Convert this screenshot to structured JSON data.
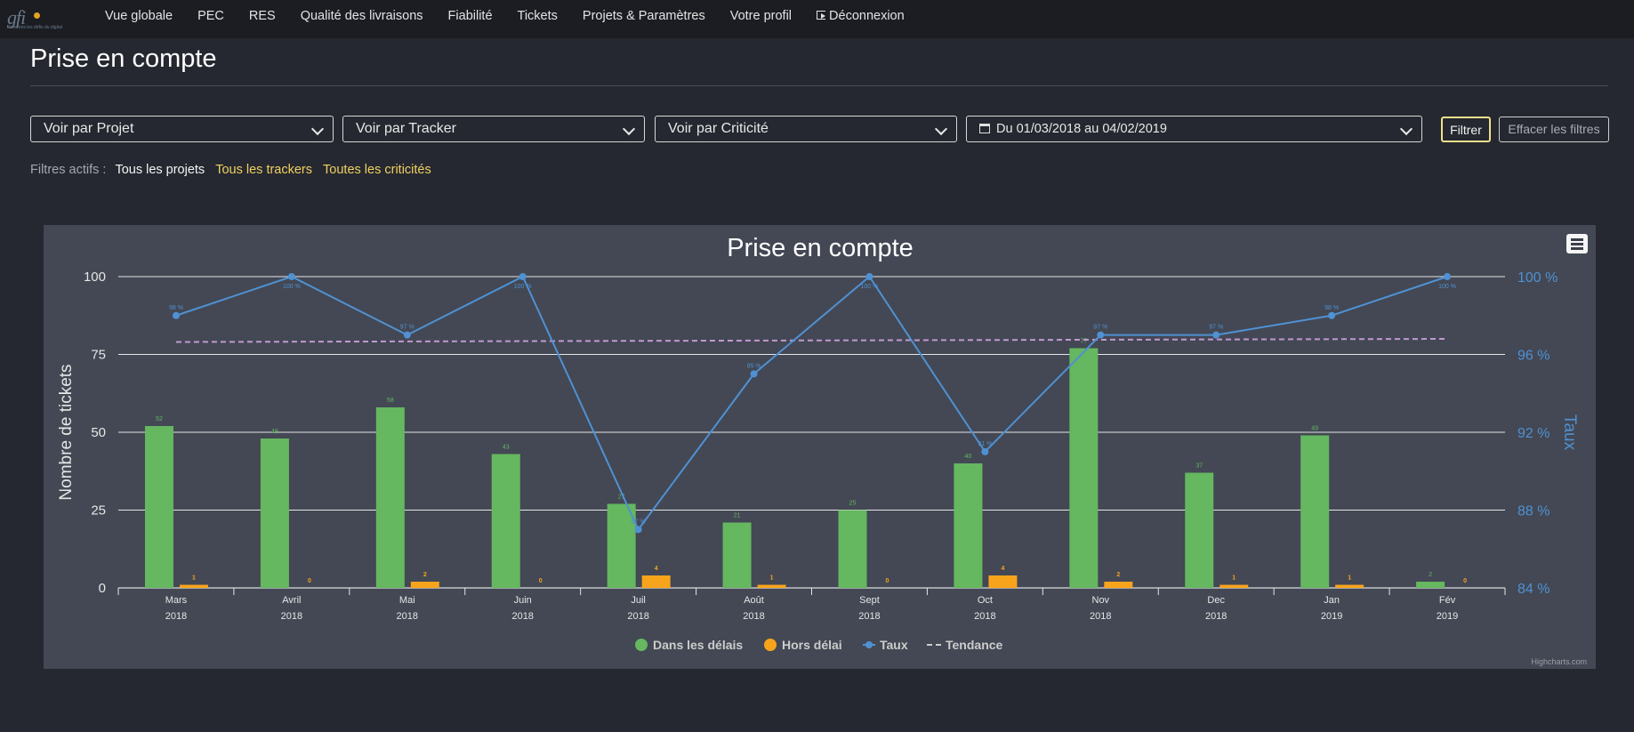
{
  "brand": {
    "logo_text": "gfi",
    "tagline": "Relevons les défis du digital"
  },
  "nav": [
    {
      "label": "Vue globale"
    },
    {
      "label": "PEC"
    },
    {
      "label": "RES"
    },
    {
      "label": "Qualité des livraisons"
    },
    {
      "label": "Fiabilité"
    },
    {
      "label": "Tickets"
    },
    {
      "label": "Projets & Paramètres"
    },
    {
      "label": "Votre profil"
    },
    {
      "label": "Déconnexion",
      "icon": "sign-out-icon"
    }
  ],
  "page": {
    "title": "Prise en compte"
  },
  "selects": {
    "projet": "Voir par Projet",
    "tracker": "Voir par Tracker",
    "criticite": "Voir par Criticité",
    "dates": "Du 01/03/2018 au 04/02/2019"
  },
  "buttons": {
    "filter": "Filtrer",
    "clear": "Effacer les filtres"
  },
  "active_filters": {
    "label": "Filtres actifs :",
    "projects": "Tous les projets",
    "trackers": "Tous les trackers",
    "criticities": "Toutes les criticités"
  },
  "colors": {
    "green": "#65b760",
    "orange": "#f7a41c",
    "blue": "#4f91d3",
    "trend": "#c299d0",
    "background": "#252830"
  },
  "chart_data": {
    "type": "bar",
    "title": "Prise en compte",
    "credits": "Highcharts.com",
    "categories": [
      "Mars",
      "Avril",
      "Mai",
      "Juin",
      "Juil",
      "Août",
      "Sept",
      "Oct",
      "Nov",
      "Dec",
      "Jan",
      "Fév"
    ],
    "years": [
      "2018",
      "2018",
      "2018",
      "2018",
      "2018",
      "2018",
      "2018",
      "2018",
      "2018",
      "2018",
      "2019",
      "2019"
    ],
    "y_left": {
      "label": "Nombre de tickets",
      "min": 0,
      "max": 100,
      "ticks": [
        "0",
        "25",
        "50",
        "75",
        "100"
      ]
    },
    "y_right": {
      "label": "Taux",
      "min": 84,
      "max": 100,
      "ticks": [
        "84 %",
        "88 %",
        "92 %",
        "96 %",
        "100 %"
      ]
    },
    "series": [
      {
        "name": "Dans les délais",
        "type": "bar",
        "axis": "left",
        "values": [
          52,
          48,
          58,
          43,
          27,
          21,
          25,
          40,
          77,
          37,
          49,
          2
        ],
        "labels": [
          "52",
          "48",
          "58",
          "43",
          "27",
          "21",
          "25",
          "40",
          "77",
          "37",
          "49",
          "2"
        ]
      },
      {
        "name": "Hors délai",
        "type": "bar",
        "axis": "left",
        "values": [
          1,
          0,
          2,
          0,
          4,
          1,
          0,
          4,
          2,
          1,
          1,
          0
        ],
        "labels": [
          "1",
          "0",
          "2",
          "0",
          "4",
          "1",
          "0",
          "4",
          "2",
          "1",
          "1",
          "0"
        ]
      },
      {
        "name": "Taux",
        "type": "line",
        "axis": "right",
        "values": [
          98,
          100,
          97,
          100,
          87,
          95,
          100,
          91,
          97,
          97,
          98,
          100
        ],
        "labels": [
          "98 %",
          "100 %",
          "97 %",
          "100 %",
          "87 %",
          "95 %",
          "100 %",
          "91 %",
          "97 %",
          "97 %",
          "98 %",
          "100 %"
        ]
      },
      {
        "name": "Tendance",
        "type": "line",
        "axis": "left",
        "style": "dashed",
        "values": [
          79,
          80
        ]
      }
    ],
    "legend": "bottom-center",
    "grid": true
  }
}
